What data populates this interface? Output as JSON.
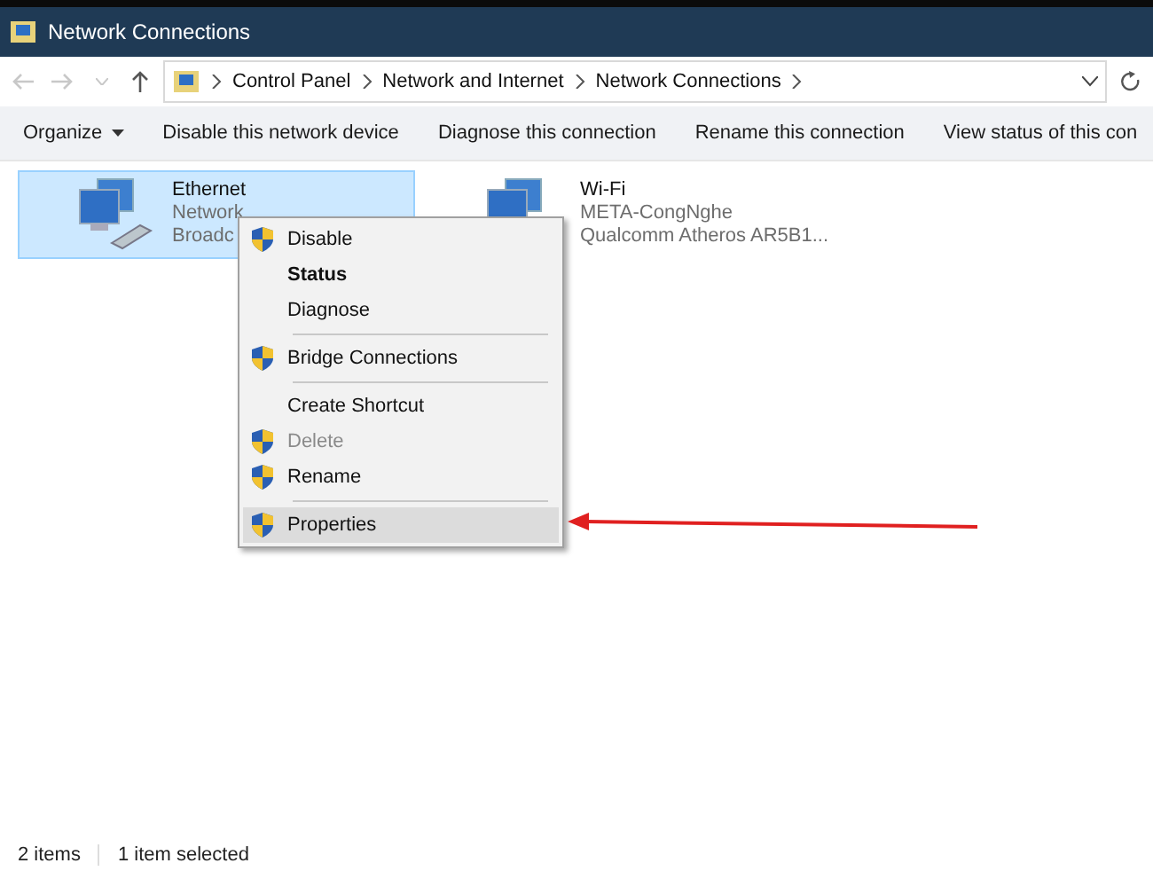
{
  "window": {
    "title": "Network Connections"
  },
  "address_bar": {
    "path": [
      "Control Panel",
      "Network and Internet",
      "Network Connections"
    ]
  },
  "toolbar": [
    {
      "label": "Organize",
      "kind": "menu"
    },
    {
      "label": "Disable this network device",
      "kind": "button"
    },
    {
      "label": "Diagnose this connection",
      "kind": "button"
    },
    {
      "label": "Rename this connection",
      "kind": "button"
    },
    {
      "label": "View status of this con",
      "kind": "button"
    }
  ],
  "connections": [
    {
      "name": "Ethernet",
      "line_2": "Network",
      "line_3": "Broadc",
      "kind": "wired",
      "selected": true
    },
    {
      "name": "Wi-Fi",
      "line_2": "META-CongNghe",
      "line_3": "Qualcomm Atheros AR5B1...",
      "kind": "wireless",
      "selected": false
    }
  ],
  "context_menu": [
    {
      "kind": "item",
      "label": "Disable",
      "shield": true,
      "bold": false,
      "disabled": false,
      "selected": false
    },
    {
      "kind": "item",
      "label": "Status",
      "shield": false,
      "bold": true,
      "disabled": false,
      "selected": false
    },
    {
      "kind": "item",
      "label": "Diagnose",
      "shield": false,
      "bold": false,
      "disabled": false,
      "selected": false
    },
    {
      "kind": "separator"
    },
    {
      "kind": "item",
      "label": "Bridge Connections",
      "shield": true,
      "bold": false,
      "disabled": false,
      "selected": false
    },
    {
      "kind": "separator"
    },
    {
      "kind": "item",
      "label": "Create Shortcut",
      "shield": false,
      "bold": false,
      "disabled": false,
      "selected": false
    },
    {
      "kind": "item",
      "label": "Delete",
      "shield": true,
      "bold": false,
      "disabled": true,
      "selected": false
    },
    {
      "kind": "item",
      "label": "Rename",
      "shield": true,
      "bold": false,
      "disabled": false,
      "selected": false
    },
    {
      "kind": "separator"
    },
    {
      "kind": "item",
      "label": "Properties",
      "shield": true,
      "bold": false,
      "disabled": false,
      "selected": true
    }
  ],
  "status_bar": [
    "2 items",
    "1 item selected"
  ]
}
